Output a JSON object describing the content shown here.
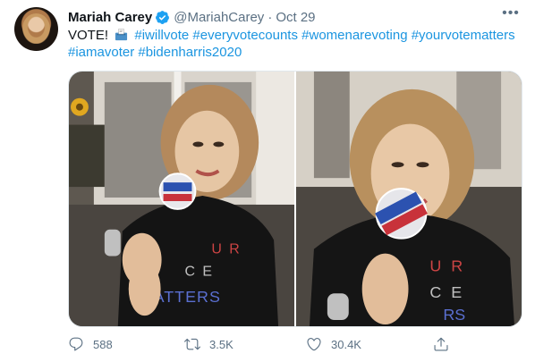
{
  "author": {
    "name": "Mariah Carey",
    "handle": "@MariahCarey",
    "separator": "·",
    "date": "Oct 29"
  },
  "more_icon": "more-horizontal-icon",
  "tweet_text": {
    "prefix": "VOTE!",
    "emoji": "ballot-box-icon",
    "hashtags": [
      "#iwillvote",
      "#everyvotecounts",
      "#womenarevoting",
      "#yourvotematters",
      "#iamavoter",
      "#bidenharris2020"
    ]
  },
  "colors": {
    "link": "#1b95e0",
    "verified": "#1da1f2",
    "muted": "#5b7083"
  },
  "stats": {
    "replies": "588",
    "retweets": "3.5K",
    "likes": "30.4K"
  },
  "icons": {
    "reply": "reply-icon",
    "retweet": "retweet-icon",
    "like": "heart-icon",
    "share": "share-icon"
  }
}
